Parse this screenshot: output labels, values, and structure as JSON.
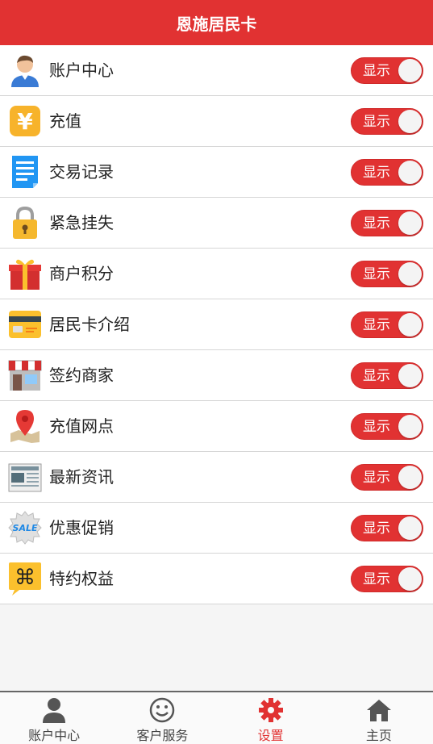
{
  "header": {
    "title": "恩施居民卡"
  },
  "toggle_text": "显示",
  "colors": {
    "accent": "#e13232",
    "toggle_on": "#e13232"
  },
  "items": [
    {
      "label": "账户中心",
      "icon": "user-avatar-icon",
      "toggle": true
    },
    {
      "label": "充值",
      "icon": "yen-coin-icon",
      "toggle": true
    },
    {
      "label": "交易记录",
      "icon": "document-icon",
      "toggle": true
    },
    {
      "label": "紧急挂失",
      "icon": "padlock-icon",
      "toggle": true
    },
    {
      "label": "商户积分",
      "icon": "gift-box-icon",
      "toggle": true
    },
    {
      "label": "居民卡介绍",
      "icon": "bank-card-icon",
      "toggle": true
    },
    {
      "label": "签约商家",
      "icon": "storefront-icon",
      "toggle": true
    },
    {
      "label": "充值网点",
      "icon": "map-pin-icon",
      "toggle": true
    },
    {
      "label": "最新资讯",
      "icon": "newspaper-icon",
      "toggle": true
    },
    {
      "label": "优惠促销",
      "icon": "sale-badge-icon",
      "toggle": true
    },
    {
      "label": "特约权益",
      "icon": "command-key-icon",
      "toggle": true
    }
  ],
  "tabs": [
    {
      "label": "账户中心",
      "icon": "person-icon",
      "active": false
    },
    {
      "label": "客户服务",
      "icon": "smiley-icon",
      "active": false
    },
    {
      "label": "设置",
      "icon": "gear-icon",
      "active": true
    },
    {
      "label": "主页",
      "icon": "home-icon",
      "active": false
    }
  ]
}
